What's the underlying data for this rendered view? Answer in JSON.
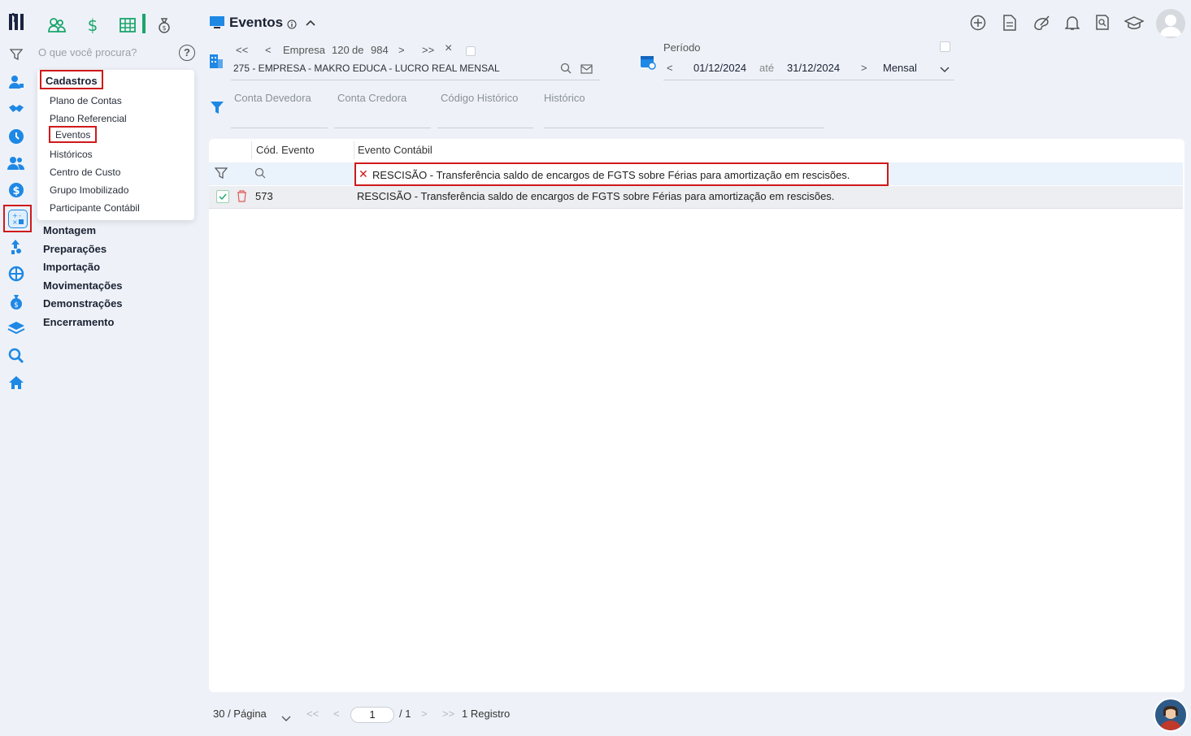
{
  "header": {
    "title": "Eventos"
  },
  "search": {
    "placeholder": "O que você procura?"
  },
  "help_label": "?",
  "menu": {
    "header": "Cadastros",
    "items": [
      "Plano de Contas",
      "Plano Referencial",
      "Eventos",
      "Históricos",
      "Centro de Custo",
      "Grupo Imobilizado",
      "Participante Contábil"
    ],
    "sections": [
      "Montagem",
      "Preparações",
      "Importação",
      "Movimentações",
      "Demonstrações",
      "Encerramento"
    ]
  },
  "empresa": {
    "first": "<<",
    "prev": "<",
    "label": "Empresa",
    "current": "120",
    "de": "de",
    "total": "984",
    "next": ">",
    "last": ">>",
    "close": "×",
    "name": "275 - EMPRESA - MAKRO EDUCA - LUCRO REAL MENSAL"
  },
  "periodo": {
    "label": "Período",
    "prev": "<",
    "start": "01/12/2024",
    "ate": "até",
    "end": "31/12/2024",
    "next": ">",
    "mode": "Mensal"
  },
  "filters": [
    "Conta Devedora",
    "Conta Credora",
    "Código Histórico",
    "Histórico"
  ],
  "table": {
    "columns": [
      "Cód. Evento",
      "Evento Contábil"
    ],
    "filter_value": "RESCISÃO - Transferência saldo de encargos de FGTS sobre Férias para amortização em rescisões.",
    "rows": [
      {
        "code": "573",
        "evento": "RESCISÃO - Transferência saldo de encargos de FGTS sobre Férias para amortização em rescisões."
      }
    ]
  },
  "pagination": {
    "per_page": "30 / Página",
    "first": "<<",
    "prev": "<",
    "page": "1",
    "total_pages": "/ 1",
    "next": ">",
    "last": ">>",
    "records": "1 Registro"
  },
  "colors": {
    "accent": "#1e88e5",
    "highlight": "#d0191b",
    "green": "#1aa56b"
  }
}
